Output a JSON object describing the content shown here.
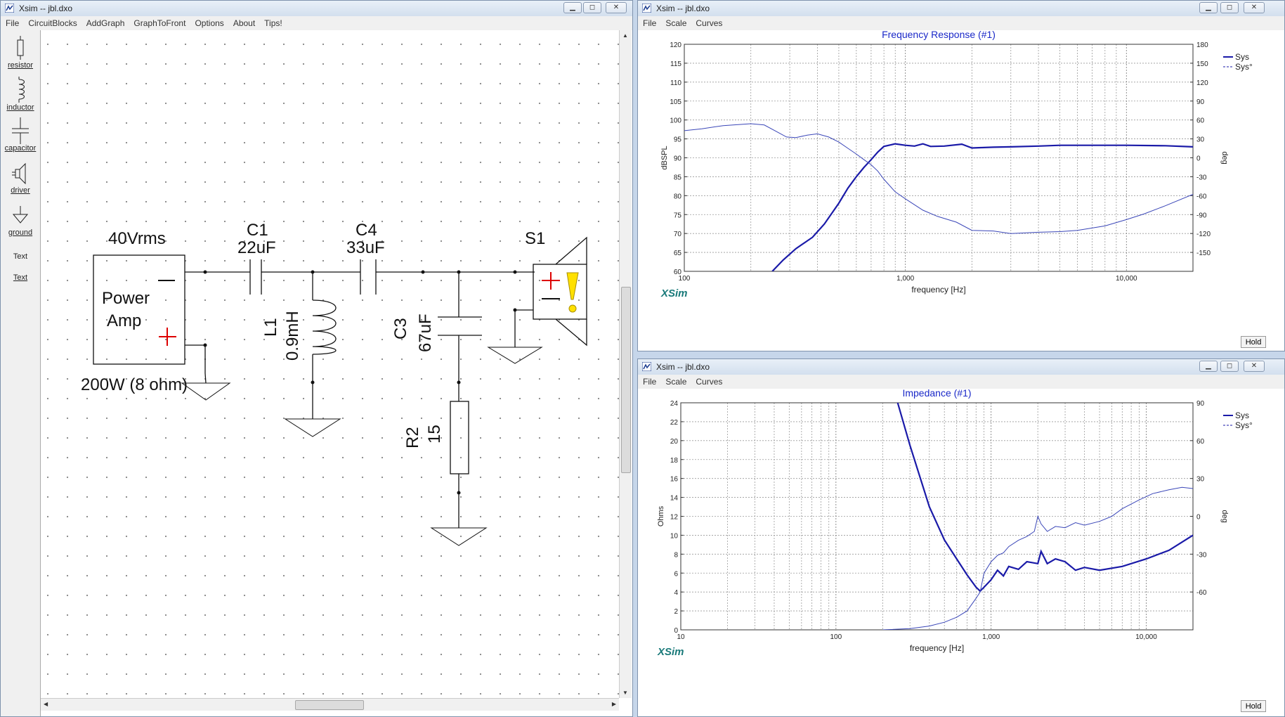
{
  "schematic_window": {
    "title": "Xsim -- jbl.dxo",
    "menu": [
      "File",
      "CircuitBlocks",
      "AddGraph",
      "GraphToFront",
      "Options",
      "About",
      "Tips!"
    ],
    "tools": [
      "resistor",
      "inductor",
      "capacitor",
      "driver",
      "ground",
      "Text",
      "Text"
    ],
    "labels": {
      "source_v": "40Vrms",
      "source_name": "Power",
      "source_name2": "Amp",
      "source_rating": "200W (8 ohm)",
      "c1_name": "C1",
      "c1_val": "22uF",
      "c4_name": "C4",
      "c4_val": "33uF",
      "l1_name": "L1",
      "l1_val": "0.9mH",
      "c3_name": "C3",
      "c3_val": "67uF",
      "r2_name": "R2",
      "r2_val": "15",
      "s1_name": "S1"
    }
  },
  "freq_window": {
    "title": "Xsim -- jbl.dxo",
    "menu": [
      "File",
      "Scale",
      "Curves"
    ],
    "hold_label": "Hold",
    "brand": "XSim",
    "chart_data": {
      "type": "line",
      "title": "Frequency Response (#1)",
      "xlabel": "frequency [Hz]",
      "ylabel": "dBSPL",
      "y2label": "deg",
      "xscale": "log",
      "xlim": [
        100,
        20000
      ],
      "ylim": [
        60,
        120
      ],
      "y2lim": [
        -180,
        180
      ],
      "xticks": [
        {
          "v": 100,
          "t": "100"
        },
        {
          "v": 1000,
          "t": "1,000"
        },
        {
          "v": 10000,
          "t": "10,000"
        }
      ],
      "yticks": [
        60,
        65,
        70,
        75,
        80,
        85,
        90,
        95,
        100,
        105,
        110,
        115,
        120
      ],
      "y2ticks": [
        {
          "v": -150,
          "t": "-150"
        },
        {
          "v": -120,
          "t": "-120"
        },
        {
          "v": -90,
          "t": "-90"
        },
        {
          "v": -60,
          "t": "-60"
        },
        {
          "v": -30,
          "t": "-30"
        },
        {
          "v": 0,
          "t": "0"
        },
        {
          "v": 30,
          "t": "30"
        },
        {
          "v": 60,
          "t": "60"
        },
        {
          "v": 90,
          "t": "90"
        },
        {
          "v": 120,
          "t": "120"
        },
        {
          "v": 150,
          "t": "150"
        },
        {
          "v": 180,
          "t": "180"
        }
      ],
      "grid": true,
      "legend": "top-right",
      "series": [
        {
          "name": "Sys",
          "axis": "left",
          "style": "solid",
          "x": [
            250,
            280,
            320,
            380,
            430,
            500,
            550,
            600,
            650,
            700,
            750,
            800,
            900,
            1000,
            1100,
            1200,
            1300,
            1500,
            1800,
            2000,
            2200,
            2500,
            3000,
            4000,
            5000,
            7000,
            10000,
            15000,
            20000
          ],
          "y": [
            60,
            63,
            66,
            69,
            72.5,
            78,
            82,
            85,
            87.5,
            89.5,
            91.5,
            93,
            93.7,
            93.3,
            93.1,
            93.7,
            93.0,
            93.1,
            93.6,
            92.6,
            92.7,
            92.8,
            92.9,
            93.1,
            93.3,
            93.3,
            93.3,
            93.2,
            92.9
          ]
        },
        {
          "name": "Sys°",
          "axis": "right",
          "style": "dashed",
          "x": [
            100,
            120,
            150,
            200,
            230,
            260,
            290,
            320,
            360,
            400,
            450,
            500,
            550,
            600,
            650,
            700,
            750,
            800,
            900,
            1000,
            1200,
            1400,
            1700,
            2000,
            2500,
            3000,
            4000,
            5000,
            6000,
            8000,
            10000,
            12000,
            15000,
            20000
          ],
          "y": [
            43,
            46,
            51,
            54,
            52,
            42,
            33,
            32,
            36,
            38,
            33,
            25,
            15,
            6,
            -3,
            -11,
            -21,
            -34,
            -54,
            -65,
            -83,
            -93,
            -102,
            -115,
            -116,
            -120,
            -118,
            -117,
            -115,
            -108,
            -98,
            -89,
            -76,
            -58
          ]
        }
      ]
    }
  },
  "imp_window": {
    "title": "Xsim -- jbl.dxo",
    "menu": [
      "File",
      "Scale",
      "Curves"
    ],
    "hold_label": "Hold",
    "brand": "XSim",
    "chart_data": {
      "type": "line",
      "title": "Impedance (#1)",
      "xlabel": "frequency [Hz]",
      "ylabel": "Ohms",
      "y2label": "deg",
      "xscale": "log",
      "xlim": [
        10,
        20000
      ],
      "ylim": [
        0,
        24
      ],
      "y2lim": [
        -90,
        90
      ],
      "xticks": [
        {
          "v": 10,
          "t": "10"
        },
        {
          "v": 100,
          "t": "100"
        },
        {
          "v": 1000,
          "t": "1,000"
        },
        {
          "v": 10000,
          "t": "10,000"
        }
      ],
      "yticks": [
        0,
        2,
        4,
        6,
        8,
        10,
        12,
        14,
        16,
        18,
        20,
        22,
        24
      ],
      "y2ticks": [
        {
          "v": -60,
          "t": "-60"
        },
        {
          "v": -30,
          "t": "-30"
        },
        {
          "v": 0,
          "t": "0"
        },
        {
          "v": 30,
          "t": "30"
        },
        {
          "v": 60,
          "t": "60"
        },
        {
          "v": 90,
          "t": "90"
        }
      ],
      "grid": true,
      "legend": "top-right",
      "series": [
        {
          "name": "Sys",
          "axis": "left",
          "style": "solid",
          "x": [
            250,
            300,
            400,
            500,
            600,
            700,
            800,
            850,
            900,
            1000,
            1100,
            1200,
            1300,
            1500,
            1700,
            2000,
            2100,
            2300,
            2600,
            3000,
            3500,
            4000,
            5000,
            7000,
            10000,
            14000,
            20000
          ],
          "y": [
            24,
            19.5,
            13,
            9.5,
            7.5,
            5.8,
            4.5,
            4.1,
            4.5,
            5.3,
            6.3,
            5.7,
            6.7,
            6.4,
            7.2,
            7.0,
            8.3,
            7.0,
            7.5,
            7.2,
            6.3,
            6.6,
            6.3,
            6.7,
            7.5,
            8.4,
            10.0
          ]
        },
        {
          "name": "Sys°",
          "axis": "right",
          "style": "dashed",
          "x": [
            200,
            300,
            400,
            500,
            600,
            700,
            800,
            850,
            900,
            1000,
            1100,
            1200,
            1300,
            1500,
            1700,
            1900,
            2000,
            2100,
            2300,
            2600,
            3000,
            3500,
            4000,
            5000,
            6000,
            7000,
            9000,
            11000,
            14000,
            17000,
            20000
          ],
          "y": [
            -90,
            -89,
            -87,
            -84,
            -80,
            -75,
            -65,
            -60,
            -45,
            -36,
            -31,
            -29,
            -24,
            -19,
            -16,
            -12,
            0,
            -6,
            -12,
            -8,
            -9,
            -5,
            -7,
            -4,
            0,
            6,
            13,
            18,
            21,
            23,
            22
          ]
        }
      ]
    }
  }
}
